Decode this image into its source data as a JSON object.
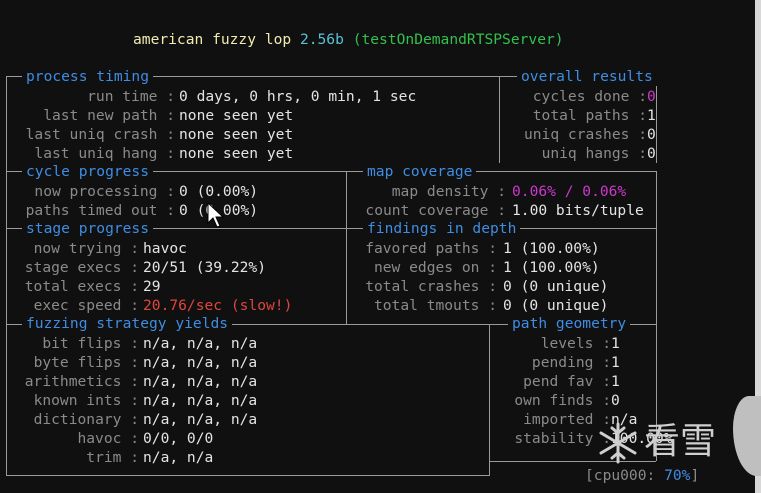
{
  "header": {
    "title": "american fuzzy lop",
    "version": "2.56b",
    "program": "(testOnDemandRTSPServer)"
  },
  "sections": {
    "process_timing": "process timing",
    "overall_results": "overall results",
    "cycle_progress": "cycle progress",
    "map_coverage": "map coverage",
    "stage_progress": "stage progress",
    "findings_in_depth": "findings in depth",
    "fuzzing_strategy_yields": "fuzzing strategy yields",
    "path_geometry": "path geometry"
  },
  "process_timing": {
    "run_time_label": "run time :",
    "run_time": "0 days, 0 hrs, 0 min, 1 sec",
    "last_new_path_label": "last new path :",
    "last_new_path": "none seen yet",
    "last_uniq_crash_label": "last uniq crash :",
    "last_uniq_crash": "none seen yet",
    "last_uniq_hang_label": "last uniq hang :",
    "last_uniq_hang": "none seen yet"
  },
  "overall_results": {
    "cycles_done_label": "cycles done :",
    "cycles_done": "0",
    "total_paths_label": "total paths :",
    "total_paths": "1",
    "uniq_crashes_label": "uniq crashes :",
    "uniq_crashes": "0",
    "uniq_hangs_label": "uniq hangs :",
    "uniq_hangs": "0"
  },
  "cycle_progress": {
    "now_processing_label": "now processing :",
    "now_processing": "0 (0.00%)",
    "paths_timed_out_label": "paths timed out :",
    "paths_timed_out": "0 (0.00%)"
  },
  "map_coverage": {
    "map_density_label": "map density :",
    "map_density": "0.06% / 0.06%",
    "count_coverage_label": "count coverage :",
    "count_coverage": "1.00 bits/tuple"
  },
  "stage_progress": {
    "now_trying_label": "now trying :",
    "now_trying": "havoc",
    "stage_execs_label": "stage execs :",
    "stage_execs": "20/51 (39.22%)",
    "total_execs_label": "total execs :",
    "total_execs": "29",
    "exec_speed_label": "exec speed :",
    "exec_speed": "20.76/sec (slow!)"
  },
  "findings_in_depth": {
    "favored_paths_label": "favored paths :",
    "favored_paths": "1 (100.00%)",
    "new_edges_on_label": "new edges on :",
    "new_edges_on": "1 (100.00%)",
    "total_crashes_label": "total crashes :",
    "total_crashes": "0 (0 unique)",
    "total_tmouts_label": "total tmouts :",
    "total_tmouts": "0 (0 unique)"
  },
  "fuzzing_strategy_yields": {
    "bit_flips_label": "bit flips :",
    "bit_flips": "n/a, n/a, n/a",
    "byte_flips_label": "byte flips :",
    "byte_flips": "n/a, n/a, n/a",
    "arithmetics_label": "arithmetics :",
    "arithmetics": "n/a, n/a, n/a",
    "known_ints_label": "known ints :",
    "known_ints": "n/a, n/a, n/a",
    "dictionary_label": "dictionary :",
    "dictionary": "n/a, n/a, n/a",
    "havoc_label": "havoc :",
    "havoc": "0/0, 0/0",
    "trim_label": "trim :",
    "trim": "n/a, n/a"
  },
  "path_geometry": {
    "levels_label": "levels :",
    "levels": "1",
    "pending_label": "pending :",
    "pending": "1",
    "pend_fav_label": "pend fav :",
    "pend_fav": "1",
    "own_finds_label": "own finds :",
    "own_finds": "0",
    "imported_label": "imported :",
    "imported": "n/a",
    "stability_label": "stability :",
    "stability": "100.00%"
  },
  "cpu": {
    "prefix": "[cpu000:",
    "value": "70%",
    "suffix": "]"
  },
  "watermark": {
    "text": "看雪",
    "icon": "snowflake-icon"
  }
}
